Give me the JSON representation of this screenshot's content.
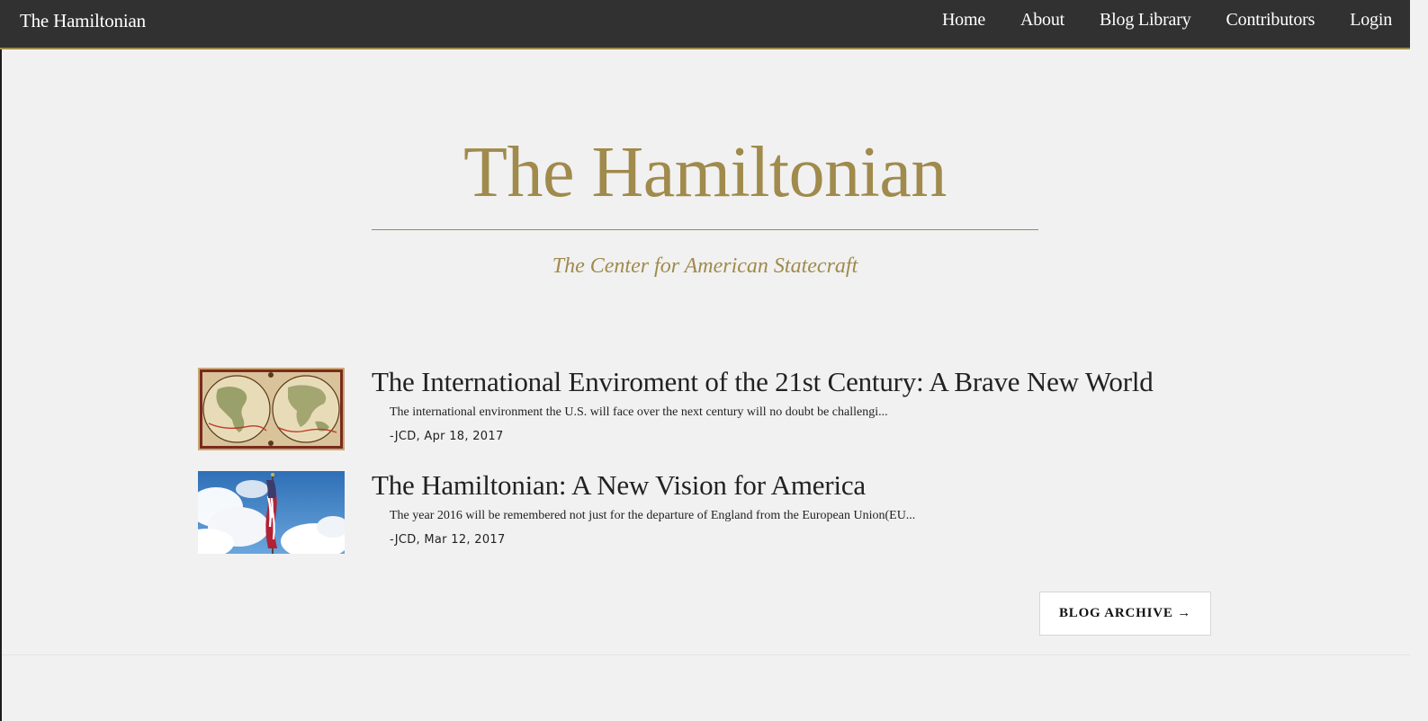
{
  "navbar": {
    "brand": "The Hamiltonian",
    "links": [
      "Home",
      "About",
      "Blog Library",
      "Contributors",
      "Login"
    ]
  },
  "hero": {
    "title": "The Hamiltonian",
    "subtitle": "The Center for American Statecraft"
  },
  "posts": [
    {
      "title": "The International Enviroment of the 21st Century: A Brave New World",
      "excerpt": "The international environment the U.S. will face over the next century will no doubt be challengi...",
      "meta": "-JCD, Apr 18, 2017",
      "thumbnail": "world-map-image"
    },
    {
      "title": "The Hamiltonian: A New Vision for America",
      "excerpt": "The year 2016 will be remembered not just for the departure of England from the European Union(EU...",
      "meta": "-JCD, Mar 12, 2017",
      "thumbnail": "american-flag-image"
    }
  ],
  "archive_button": "BLOG ARCHIVE →",
  "colors": {
    "navbar_bg": "#313131",
    "accent_gold": "#a08a4c",
    "page_bg": "#f1f1f1"
  }
}
